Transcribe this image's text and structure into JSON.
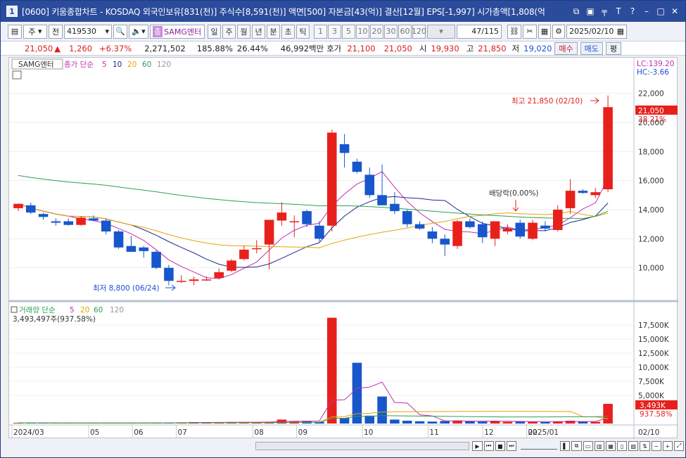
{
  "window": {
    "badge": "1",
    "title": "[0600] 키움종합차트 - KOSDAQ 외국인보유[831(천)] 주식수[8,591(천)] 액면[500] 자본금[43(억)] 결산[12월] EPS[-1,997] 시가총액[1,808(억"
  },
  "toolbar": {
    "market": "주",
    "jeon_label": "전",
    "code": "419530",
    "name": "SAMG엔터",
    "jong_label": "종",
    "periods": [
      "일",
      "주",
      "월",
      "년",
      "분",
      "초",
      "틱"
    ],
    "selected_period": "주",
    "intervals": [
      "1",
      "3",
      "5",
      "10",
      "20",
      "30",
      "60",
      "120"
    ],
    "count": "47",
    "total": "/115",
    "date": "2025/02/10"
  },
  "quote": {
    "price": "21,050",
    "arrow": "▲",
    "change": "1,260",
    "change_pct": "+6.37%",
    "volume": "2,271,502",
    "volume_ratio": "185.88%",
    "turnover": "26.44%",
    "amount": "46,992백만",
    "hoga_label": "호가",
    "ask": "21,100",
    "bid": "21,050",
    "open_label": "시",
    "open": "19,930",
    "high_label": "고",
    "high": "21,850",
    "low_label": "저",
    "low": "19,020",
    "buy_label": "매수",
    "sell_label": "매도",
    "eval_label": "평"
  },
  "price_panel": {
    "stock_tag": "SAMG엔터",
    "legend_prefix": "종가 단순",
    "ma_periods": [
      "5",
      "10",
      "20",
      "60",
      "120"
    ],
    "ma_colors": [
      "#c02fb0",
      "#1c2a8c",
      "#e6a500",
      "#2f9e55",
      "#999999"
    ],
    "lc": "LC:139.20",
    "hc": "HC:-3.66",
    "high_annotation": "최고 21,850 (02/10)",
    "low_annotation": "최저 8,800 (06/24)",
    "dividend_annotation": "배당락(0.00%)",
    "current_price_tag": "21,050",
    "current_pct_tag": "38.21%",
    "y_ticks": [
      "22,000",
      "20,000",
      "18,000",
      "16,000",
      "14,000",
      "12,000",
      "10,000"
    ]
  },
  "volume_panel": {
    "legend": "거래량 단순",
    "ma_periods": [
      "5",
      "20",
      "60",
      "120"
    ],
    "info": "3,493,497주(937.58%)",
    "current_tag": "3,493K",
    "current_pct": "937.58%",
    "y_ticks": [
      "17,500K",
      "15,000K",
      "12,500K",
      "10,000K",
      "7,500K",
      "5,000K"
    ]
  },
  "x_axis": {
    "labels": [
      "2024/03",
      "05",
      "06",
      "07",
      "08",
      "09",
      "10",
      "11",
      "12",
      "2025/01",
      "02"
    ],
    "last_label": "02/10"
  },
  "colors": {
    "up": "#e8201c",
    "down": "#1856cc",
    "title_bg": "#2b4b9b"
  },
  "chart_data": {
    "type": "candlestick",
    "unit": "KRW",
    "candles": [
      {
        "o": 14100,
        "h": 14400,
        "l": 13900,
        "c": 14400
      },
      {
        "o": 14300,
        "h": 14500,
        "l": 13700,
        "c": 13800
      },
      {
        "o": 13700,
        "h": 13800,
        "l": 13300,
        "c": 13500
      },
      {
        "o": 13200,
        "h": 13400,
        "l": 12900,
        "c": 13100
      },
      {
        "o": 13200,
        "h": 13400,
        "l": 12900,
        "c": 12950
      },
      {
        "o": 12950,
        "h": 13550,
        "l": 12900,
        "c": 13450
      },
      {
        "o": 13400,
        "h": 13600,
        "l": 13200,
        "c": 13250
      },
      {
        "o": 13250,
        "h": 13400,
        "l": 12300,
        "c": 12500
      },
      {
        "o": 12500,
        "h": 12600,
        "l": 11300,
        "c": 11400
      },
      {
        "o": 11500,
        "h": 12200,
        "l": 11200,
        "c": 11100
      },
      {
        "o": 11400,
        "h": 11500,
        "l": 10700,
        "c": 11150
      },
      {
        "o": 11100,
        "h": 11200,
        "l": 9900,
        "c": 10000
      },
      {
        "o": 10000,
        "h": 10200,
        "l": 8800,
        "c": 9100
      },
      {
        "o": 9100,
        "h": 9500,
        "l": 8950,
        "c": 9100
      },
      {
        "o": 9100,
        "h": 9400,
        "l": 8800,
        "c": 9200
      },
      {
        "o": 9200,
        "h": 9400,
        "l": 9100,
        "c": 9200
      },
      {
        "o": 9300,
        "h": 9950,
        "l": 9200,
        "c": 9700
      },
      {
        "o": 9800,
        "h": 10600,
        "l": 9700,
        "c": 10500
      },
      {
        "o": 10600,
        "h": 11500,
        "l": 10500,
        "c": 11250
      },
      {
        "o": 11350,
        "h": 11900,
        "l": 11000,
        "c": 11350
      },
      {
        "o": 11600,
        "h": 13300,
        "l": 9900,
        "c": 13300
      },
      {
        "o": 13250,
        "h": 14500,
        "l": 12900,
        "c": 13800
      },
      {
        "o": 13200,
        "h": 13600,
        "l": 12100,
        "c": 13200
      },
      {
        "o": 13900,
        "h": 14000,
        "l": 12800,
        "c": 13000
      },
      {
        "o": 12900,
        "h": 13200,
        "l": 11800,
        "c": 12000
      },
      {
        "o": 12900,
        "h": 19500,
        "l": 12500,
        "c": 19300
      },
      {
        "o": 18500,
        "h": 19200,
        "l": 16900,
        "c": 17900
      },
      {
        "o": 17300,
        "h": 17500,
        "l": 16500,
        "c": 16600
      },
      {
        "o": 16400,
        "h": 16900,
        "l": 14800,
        "c": 15000
      },
      {
        "o": 15000,
        "h": 17100,
        "l": 14700,
        "c": 14300
      },
      {
        "o": 14400,
        "h": 15200,
        "l": 13700,
        "c": 13900
      },
      {
        "o": 13900,
        "h": 14000,
        "l": 12800,
        "c": 13000
      },
      {
        "o": 13000,
        "h": 13200,
        "l": 12600,
        "c": 12700
      },
      {
        "o": 12500,
        "h": 12800,
        "l": 11700,
        "c": 12000
      },
      {
        "o": 12000,
        "h": 12300,
        "l": 10800,
        "c": 11600
      },
      {
        "o": 11500,
        "h": 13300,
        "l": 11300,
        "c": 13200
      },
      {
        "o": 13200,
        "h": 13400,
        "l": 12700,
        "c": 12800
      },
      {
        "o": 13000,
        "h": 13200,
        "l": 11700,
        "c": 12100
      },
      {
        "o": 12000,
        "h": 13200,
        "l": 11500,
        "c": 13200
      },
      {
        "o": 12500,
        "h": 13000,
        "l": 12300,
        "c": 12700
      },
      {
        "o": 13100,
        "h": 13300,
        "l": 12000,
        "c": 12150
      },
      {
        "o": 12000,
        "h": 13300,
        "l": 11900,
        "c": 13100
      },
      {
        "o": 12900,
        "h": 13200,
        "l": 12500,
        "c": 12700
      },
      {
        "o": 12600,
        "h": 14300,
        "l": 12500,
        "c": 14000
      },
      {
        "o": 14100,
        "h": 16100,
        "l": 13700,
        "c": 15300
      },
      {
        "o": 15300,
        "h": 15400,
        "l": 15100,
        "c": 15150
      },
      {
        "o": 15000,
        "h": 15500,
        "l": 14800,
        "c": 15200
      },
      {
        "o": 15400,
        "h": 21850,
        "l": 15200,
        "c": 21050
      }
    ],
    "volume_k": [
      120,
      110,
      100,
      90,
      110,
      80,
      95,
      110,
      105,
      100,
      120,
      130,
      160,
      200,
      250,
      180,
      220,
      260,
      260,
      250,
      300,
      700,
      450,
      500,
      300,
      18800,
      1000,
      10800,
      1400,
      4800,
      700,
      500,
      400,
      350,
      450,
      550,
      400,
      350,
      450,
      300,
      350,
      300,
      250,
      400,
      500,
      350,
      300,
      3493
    ],
    "price_ylim": [
      8000,
      23000
    ],
    "volume_ylim": [
      0,
      20000
    ]
  }
}
